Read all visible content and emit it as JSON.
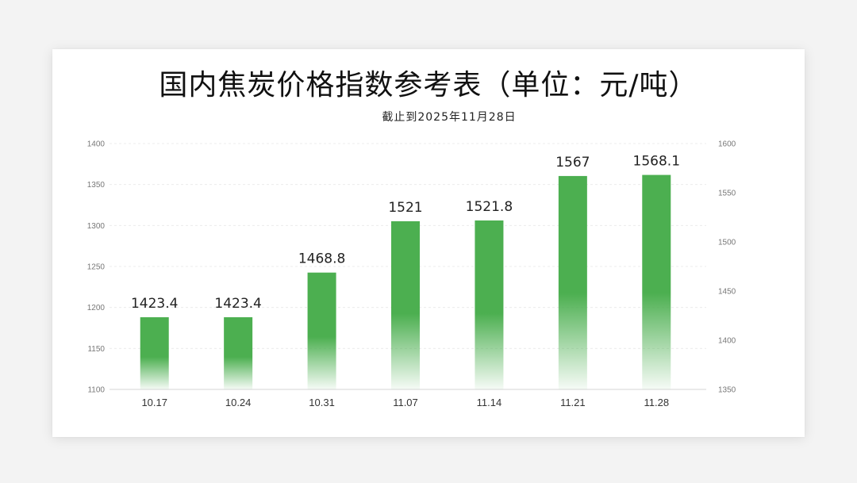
{
  "chart_data": {
    "type": "bar",
    "title": "国内焦炭价格指数参考表（单位：元/吨）",
    "subtitle": "截止到2025年11月28日",
    "categories": [
      "10.17",
      "10.24",
      "10.31",
      "11.07",
      "11.14",
      "11.21",
      "11.28"
    ],
    "series": [
      {
        "values": [
          1423.4,
          1423.4,
          1468.8,
          1521,
          1521.8,
          1567,
          1568.1
        ]
      }
    ],
    "data_labels": [
      "1423.4",
      "1423.4",
      "1468.8",
      "1521",
      "1521.8",
      "1567",
      "1568.1"
    ],
    "y_left": {
      "range": [
        1100,
        1400
      ],
      "ticks": [
        "1100",
        "1150",
        "1200",
        "1250",
        "1300",
        "1350",
        "1400"
      ]
    },
    "y_right": {
      "range": [
        1350,
        1600
      ],
      "ticks": [
        "1350",
        "1400",
        "1450",
        "1500",
        "1550",
        "1600"
      ]
    },
    "grid": true,
    "bar_color": "#4caf50"
  }
}
